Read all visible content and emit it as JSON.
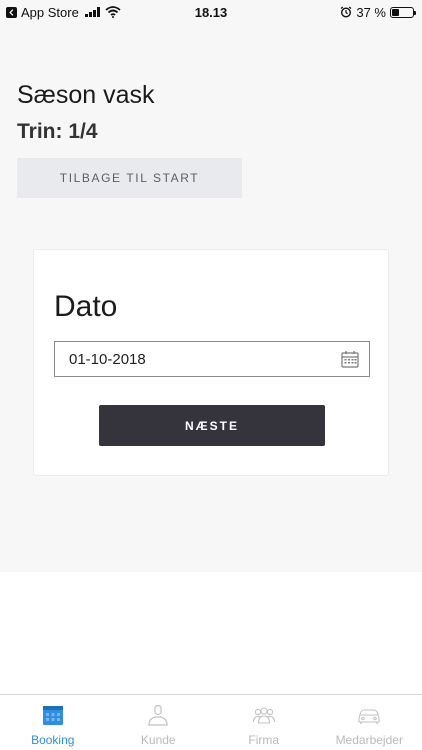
{
  "status_bar": {
    "back_label": "App Store",
    "time": "18.13",
    "battery_text": "37 %",
    "battery_level_percent": 37
  },
  "header": {
    "title": "Sæson vask",
    "step": "Trin: 1/4",
    "back_to_start_label": "TILBAGE TIL START"
  },
  "card": {
    "title": "Dato",
    "date_value": "01-10-2018",
    "next_label": "NÆSTE"
  },
  "tabs": [
    {
      "label": "Booking",
      "icon": "calendar-icon",
      "active": true
    },
    {
      "label": "Kunde",
      "icon": "person-icon",
      "active": false
    },
    {
      "label": "Firma",
      "icon": "group-icon",
      "active": false
    },
    {
      "label": "Medarbejder",
      "icon": "car-icon",
      "active": false
    }
  ],
  "colors": {
    "accent": "#2f8ee0",
    "button_dark": "#35343d",
    "background": "#f7f7f7"
  }
}
